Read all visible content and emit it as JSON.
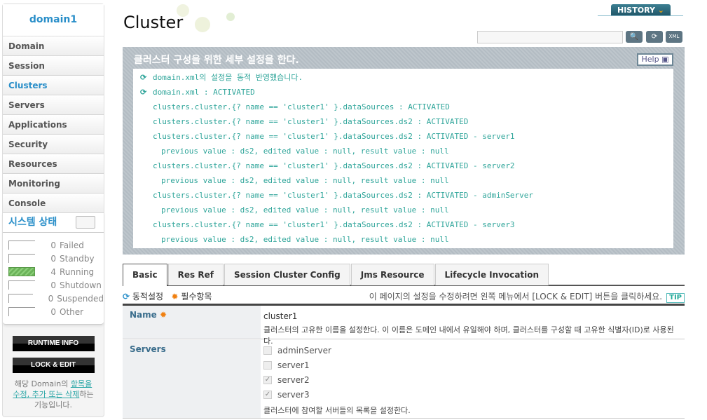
{
  "sidebar": {
    "domain": "domain1",
    "items": [
      "Domain",
      "Session",
      "Clusters",
      "Servers",
      "Applications",
      "Security",
      "Resources",
      "Monitoring",
      "Console"
    ],
    "active": "Clusters",
    "status": {
      "title": "시스템 상태",
      "rows": [
        {
          "count": "0",
          "label": "Failed",
          "level": 0
        },
        {
          "count": "0",
          "label": "Standby",
          "level": 0
        },
        {
          "count": "4",
          "label": "Running",
          "level": 1
        },
        {
          "count": "0",
          "label": "Shutdown",
          "level": 0
        },
        {
          "count": "0",
          "label": "Suspended",
          "level": 0
        },
        {
          "count": "0",
          "label": "Other",
          "level": 0
        }
      ]
    },
    "runtime_info": "RUNTIME INFO",
    "lock_edit": "LOCK & EDIT",
    "note": {
      "pre": "해당 Domain의 ",
      "link": "항목을 수정, 추가 또는 삭제",
      "post": "하는 기능입니다."
    }
  },
  "header": {
    "title": "Cluster",
    "history": "HISTORY",
    "search_value": "",
    "icons": [
      "search-icon",
      "refresh-icon",
      "xml-export-icon"
    ]
  },
  "panel": {
    "title": "클러스터 구성을 위한 세부 설정을 한다.",
    "help": "Help",
    "log": [
      {
        "icon": true,
        "indent": 0,
        "text": "domain.xml의 설정을 동적 반영했습니다."
      },
      {
        "icon": true,
        "indent": 0,
        "text": "domain.xml : ACTIVATED"
      },
      {
        "indent": 1,
        "text": "clusters.cluster.{? name == 'cluster1' }.dataSources : ACTIVATED"
      },
      {
        "indent": 1,
        "text": "clusters.cluster.{? name == 'cluster1' }.dataSources.ds2 : ACTIVATED"
      },
      {
        "indent": 1,
        "text": "clusters.cluster.{? name == 'cluster1' }.dataSources.ds2 : ACTIVATED - server1"
      },
      {
        "indent": 2,
        "text": "previous value : ds2, edited value : null, result value : null"
      },
      {
        "indent": 1,
        "text": "clusters.cluster.{? name == 'cluster1' }.dataSources.ds2 : ACTIVATED - server2"
      },
      {
        "indent": 2,
        "text": "previous value : ds2, edited value : null, result value : null"
      },
      {
        "indent": 1,
        "text": "clusters.cluster.{? name == 'cluster1' }.dataSources.ds2 : ACTIVATED - adminServer"
      },
      {
        "indent": 2,
        "text": "previous value : ds2, edited value : null, result value : null"
      },
      {
        "indent": 1,
        "text": "clusters.cluster.{? name == 'cluster1' }.dataSources.ds2 : ACTIVATED - server3"
      },
      {
        "indent": 2,
        "text": "previous value : ds2, edited value : null, result value : null"
      }
    ]
  },
  "tabs": [
    "Basic",
    "Res Ref",
    "Session Cluster Config",
    "Jms Resource",
    "Lifecycle Invocation"
  ],
  "legend": {
    "dynamic": "동적설정",
    "required": "필수항목",
    "tip": "이 페이지의 설정을 수정하려면 왼쪽 메뉴에서 [LOCK & EDIT] 버튼을 클릭하세요.",
    "tip_badge": "TIP"
  },
  "form": {
    "name": {
      "label": "Name",
      "value": "cluster1",
      "desc": "클러스터의 고유한 이름을 설정한다. 이 이름은 도메인 내에서 유일해야 하며, 클러스터를 구성할 때 고유한 식별자(ID)로 사용된다."
    },
    "servers": {
      "label": "Servers",
      "options": [
        {
          "label": "adminServer",
          "checked": false
        },
        {
          "label": "server1",
          "checked": false
        },
        {
          "label": "server2",
          "checked": true
        },
        {
          "label": "server3",
          "checked": true
        }
      ],
      "desc": "클러스터에 참여할 서버들의 목록을 설정한다."
    }
  },
  "colors": {
    "accent": "#2a8fc9",
    "log_text": "#2fa59a",
    "required": "#f08010"
  }
}
